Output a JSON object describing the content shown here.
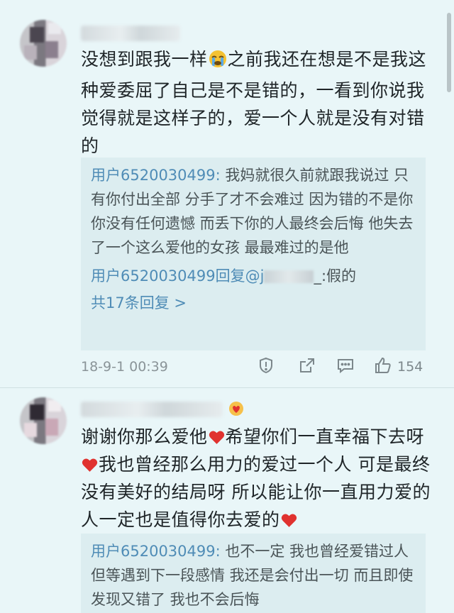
{
  "comments": [
    {
      "text_parts": [
        "没想到跟我一样",
        "之前我还在想是不是我这种爱委屈了自己是不是错的，一看到你说我觉得就是这样子的，爱一个人就是没有对错的"
      ],
      "reply_user": "用户6520030499:",
      "reply_text": "我妈就很久前就跟我说过 只有你付出全部 分手了才不会难过 因为错的不是你你没有任何遗憾  而丢下你的人最终会后悔 他失去了一个这么爱他的女孩 最最难过的是他",
      "reply2_user": "用户6520030499",
      "reply2_mid": "回复@j",
      "reply2_tail": "_:假的",
      "more_replies": "共17条回复 >",
      "timestamp": "18-9-1 00:39",
      "like_count": "154"
    },
    {
      "text_parts": [
        "谢谢你那么爱他",
        "希望你们一直幸福下去呀",
        "我也曾经那么用力的爱过一个人 可是最终没有美好的结局呀 所以能让你一直用力爱的人一定也是值得你去爱的"
      ],
      "reply_user": "用户6520030499:",
      "reply_text": "也不一定 我也曾经爱错过人 但等遇到下一段感情 我还是会付出一切 而且即使发现又错了 我也不会后悔"
    }
  ],
  "icons": [
    "crying-face-emoji",
    "heart-emoji",
    "report-icon",
    "share-icon",
    "comment-icon",
    "like-icon",
    "badge-icon"
  ],
  "colors": {
    "background": "#e9f6f8",
    "reply_background": "#dcedf0",
    "link": "#4f8cb6",
    "heart": "#e0322f"
  }
}
